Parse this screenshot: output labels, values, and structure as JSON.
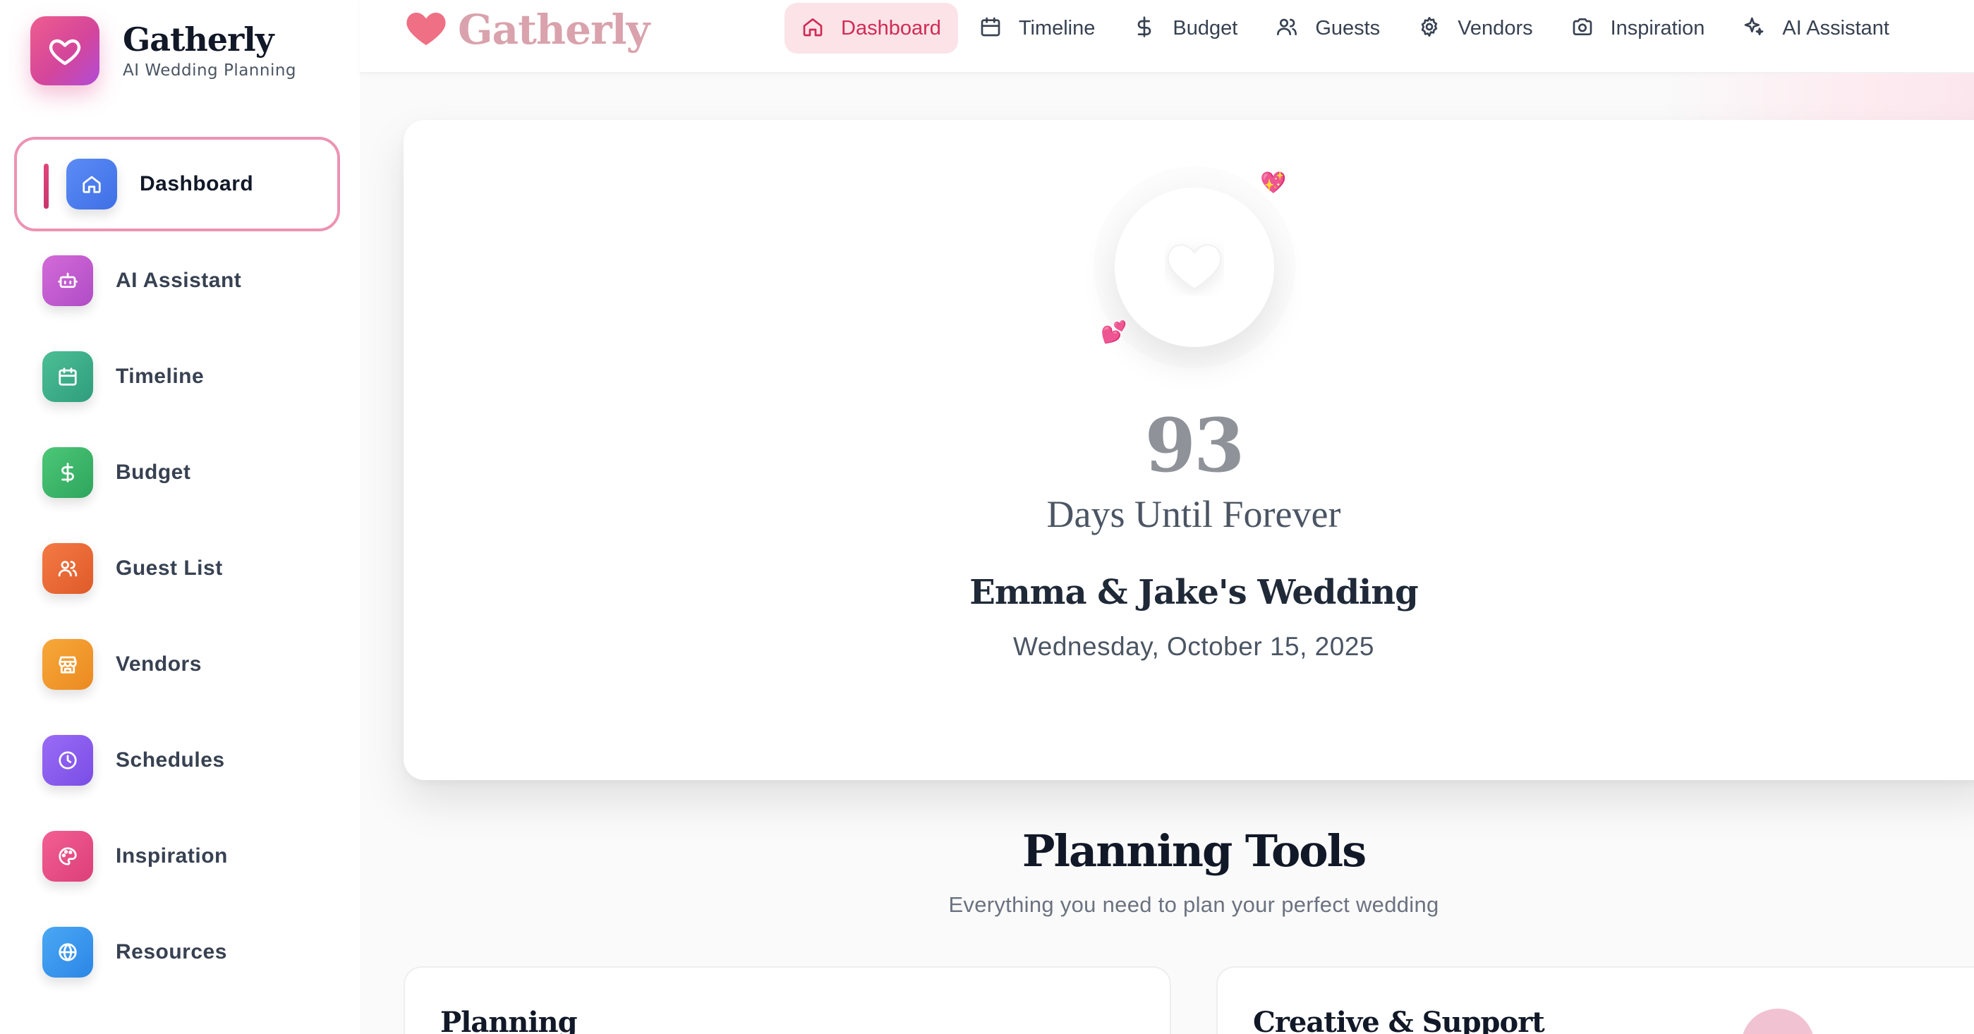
{
  "brand": {
    "name": "Gatherly",
    "tagline": "AI Wedding Planning"
  },
  "sidebar": {
    "items": [
      {
        "label": "Dashboard",
        "icon": "home-icon",
        "color": "#4f7ff0",
        "active": true
      },
      {
        "label": "AI Assistant",
        "icon": "bot-icon",
        "color": "#c65bd0"
      },
      {
        "label": "Timeline",
        "icon": "calendar-icon",
        "color": "#3fae8c"
      },
      {
        "label": "Budget",
        "icon": "dollar-icon",
        "color": "#3db56a"
      },
      {
        "label": "Guest List",
        "icon": "users-icon",
        "color": "#ee6a3c"
      },
      {
        "label": "Vendors",
        "icon": "store-icon",
        "color": "#f39a2d"
      },
      {
        "label": "Schedules",
        "icon": "clock-icon",
        "color": "#8a5cf2"
      },
      {
        "label": "Inspiration",
        "icon": "palette-icon",
        "color": "#ec4c86"
      },
      {
        "label": "Resources",
        "icon": "globe-icon",
        "color": "#3a9bf0"
      }
    ]
  },
  "topbar": {
    "brand_name": "Gatherly",
    "nav": [
      {
        "label": "Dashboard",
        "icon": "home-icon",
        "active": true
      },
      {
        "label": "Timeline",
        "icon": "calendar-icon"
      },
      {
        "label": "Budget",
        "icon": "dollar-icon"
      },
      {
        "label": "Guests",
        "icon": "users-icon"
      },
      {
        "label": "Vendors",
        "icon": "gear-icon"
      },
      {
        "label": "Inspiration",
        "icon": "camera-icon"
      },
      {
        "label": "AI Assistant",
        "icon": "sparkles-icon"
      }
    ]
  },
  "hero": {
    "countdown_days": "93",
    "countdown_label": "Days Until Forever",
    "couple_title": "Emma & Jake's Wedding",
    "wedding_date": "Wednesday, October 15, 2025",
    "emoji_a": "💖",
    "emoji_b": "💕"
  },
  "planning": {
    "title": "Planning Tools",
    "subtitle": "Everything you need to plan your perfect wedding",
    "cards": [
      {
        "title": "Planning"
      },
      {
        "title": "Creative & Support"
      }
    ]
  },
  "colors": {
    "accent": "#d02b55",
    "active_bg": "#fbe3e7",
    "active_border": "#ec93b3"
  }
}
